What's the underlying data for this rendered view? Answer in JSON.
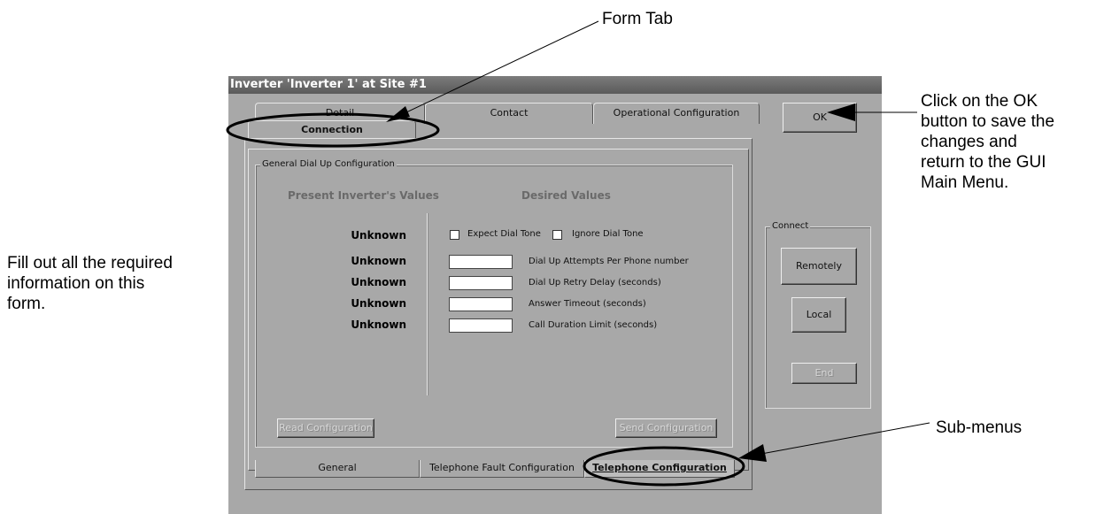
{
  "annotations": {
    "form_tab": "Form Tab",
    "ok_callout_lines": [
      "Click on the OK",
      "button to save the",
      "changes and",
      "return to the GUI",
      "Main Menu."
    ],
    "fill_out_lines": [
      "Fill out all the required",
      "information on this",
      "form."
    ],
    "sub_menus": "Sub-menus"
  },
  "window": {
    "title": "Inverter 'Inverter 1' at Site #1"
  },
  "tabs": {
    "detail": "Detail",
    "contact": "Contact",
    "operational": "Operational Configuration",
    "connection": "Connection"
  },
  "group": {
    "legend": "General Dial Up Configuration",
    "present_header": "Present Inverter's Values",
    "desired_header": "Desired Values",
    "expect_dial_tone": "Expect Dial Tone",
    "ignore_dial_tone": "Ignore Dial Tone",
    "rows": [
      {
        "present": "Unknown",
        "label": "Dial Up Attempts Per Phone number",
        "value": ""
      },
      {
        "present": "Unknown",
        "label": "Dial Up Retry Delay (seconds)",
        "value": ""
      },
      {
        "present": "Unknown",
        "label": "Answer Timeout (seconds)",
        "value": ""
      },
      {
        "present": "Unknown",
        "label": "Call Duration Limit (seconds)",
        "value": ""
      }
    ],
    "dial_tone_present": "Unknown",
    "read_button": "Read Configuration",
    "send_button": "Send Configuration"
  },
  "bottom_tabs": {
    "general": "General",
    "telephone_fault": "Telephone Fault Configuration",
    "telephone_config": "Telephone Configuration"
  },
  "buttons": {
    "ok": "OK"
  },
  "connect": {
    "legend": "Connect",
    "remotely": "Remotely",
    "local": "Local",
    "end": "End"
  }
}
